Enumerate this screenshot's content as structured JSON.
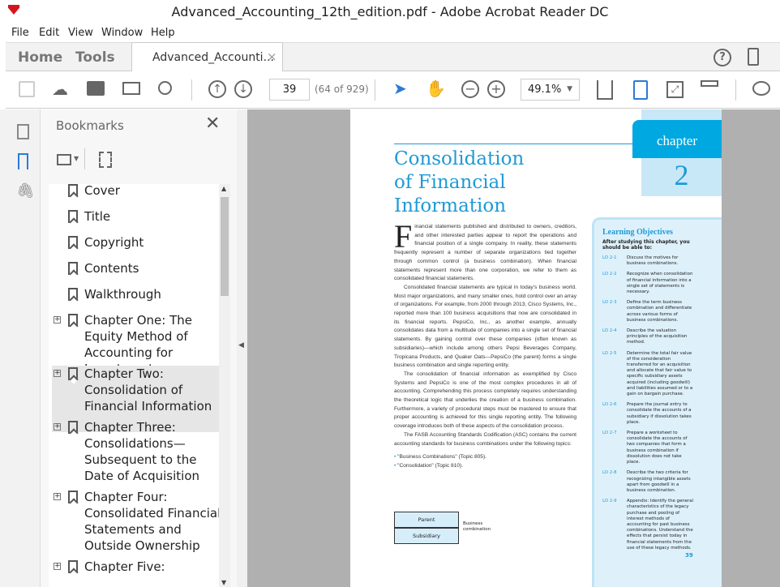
{
  "window": {
    "title": "Advanced_Accounting_12th_edition.pdf - Adobe Acrobat Reader DC"
  },
  "menu": [
    "File",
    "Edit",
    "View",
    "Window",
    "Help"
  ],
  "tabs": {
    "home": "Home",
    "tools": "Tools",
    "document": "Advanced_Accounti...",
    "close": "×"
  },
  "toolbar": {
    "page_current": "39",
    "page_info": "(64 of 929)",
    "zoom": "49.1%"
  },
  "bookmarks": {
    "title": "Bookmarks",
    "items": [
      {
        "label": "Cover",
        "expandable": false
      },
      {
        "label": "Title",
        "expandable": false
      },
      {
        "label": "Copyright",
        "expandable": false
      },
      {
        "label": "Contents",
        "expandable": false
      },
      {
        "label": "Walkthrough",
        "expandable": false
      },
      {
        "label": "Chapter One: The Equity Method of Accounting for Investments",
        "expandable": true
      },
      {
        "label": "Chapter Two: Consolidation of Financial Information",
        "expandable": true,
        "selected": true
      },
      {
        "label": "Chapter Three: Consolidations—Subsequent to the Date of Acquisition",
        "expandable": true
      },
      {
        "label": "Chapter Four: Consolidated Financial Statements and Outside Ownership",
        "expandable": true
      },
      {
        "label": "Chapter Five:",
        "expandable": true
      }
    ]
  },
  "pdf": {
    "chapter_label": "chapter",
    "chapter_number": "2",
    "title_lines": [
      "Consolidation",
      "of Financial",
      "Information"
    ],
    "drop_cap": "F",
    "paragraphs": [
      "inancial statements published and distributed to owners, creditors, and other interested parties appear to report the operations and financial position of a single company. In reality, these statements frequently represent a number of separate organizations tied together through common control (a business combination). When financial statements represent more than one corporation, we refer to them as consolidated financial statements.",
      "Consolidated financial statements are typical in today's business world. Most major organizations, and many smaller ones, hold control over an array of organizations. For example, from 2000 through 2013, Cisco Systems, Inc., reported more than 100 business acquisitions that now are consolidated in its financial reports. PepsiCo, Inc., as another example, annually consolidates data from a multitude of companies into a single set of financial statements. By gaining control over these companies (often known as subsidiaries)—which include among others Pepsi Beverages Company, Tropicana Products, and Quaker Oats—PepsiCo (the parent) forms a single business combination and single reporting entity.",
      "The consolidation of financial information as exemplified by Cisco Systems and PepsiCo is one of the most complex procedures in all of accounting. Comprehending this process completely requires understanding the theoretical logic that underlies the creation of a business combination. Furthermore, a variety of procedural steps must be mastered to ensure that proper accounting is achieved for this single reporting entity. The following coverage introduces both of these aspects of the consolidation process.",
      "The FASB Accounting Standards Codification (ASC) contains the current accounting standards for business combinations under the following topics:"
    ],
    "bullets": [
      "\"Business Combinations\" (Topic 805).",
      "\"Consolidation\" (Topic 810)."
    ],
    "diagram": {
      "parent": "Parent",
      "subsidiary": "Subsidiary",
      "label": "Business combination"
    },
    "learning_objectives": {
      "title": "Learning Objectives",
      "intro": "After studying this chapter, you should be able to:",
      "items": [
        {
          "code": "LO 2-1",
          "text": "Discuss the motives for business combinations."
        },
        {
          "code": "LO 2-2",
          "text": "Recognize when consolidation of financial information into a single set of statements is necessary."
        },
        {
          "code": "LO 2-3",
          "text": "Define the term business combination and differentiate across various forms of business combinations."
        },
        {
          "code": "LO 2-4",
          "text": "Describe the valuation principles of the acquisition method."
        },
        {
          "code": "LO 2-5",
          "text": "Determine the total fair value of the consideration transferred for an acquisition and allocate that fair value to specific subsidiary assets acquired (including goodwill) and liabilities assumed or to a gain on bargain purchase."
        },
        {
          "code": "LO 2-6",
          "text": "Prepare the journal entry to consolidate the accounts of a subsidiary if dissolution takes place."
        },
        {
          "code": "LO 2-7",
          "text": "Prepare a worksheet to consolidate the accounts of two companies that form a business combination if dissolution does not take place."
        },
        {
          "code": "LO 2-8",
          "text": "Describe the two criteria for recognizing intangible assets apart from goodwill in a business combination."
        },
        {
          "code": "LO 2-9",
          "text": "Appendix: Identify the general characteristics of the legacy purchase and pooling of interest methods of accounting for past business combinations. Understand the effects that persist today in financial statements from the use of these legacy methods."
        }
      ]
    },
    "page_number": "39"
  },
  "colors": {
    "accent": "#1e9ad6",
    "chapter_tab": "#00a8e1",
    "lo_bg": "#def1fb",
    "doc_bg": "#b0b0b0"
  }
}
